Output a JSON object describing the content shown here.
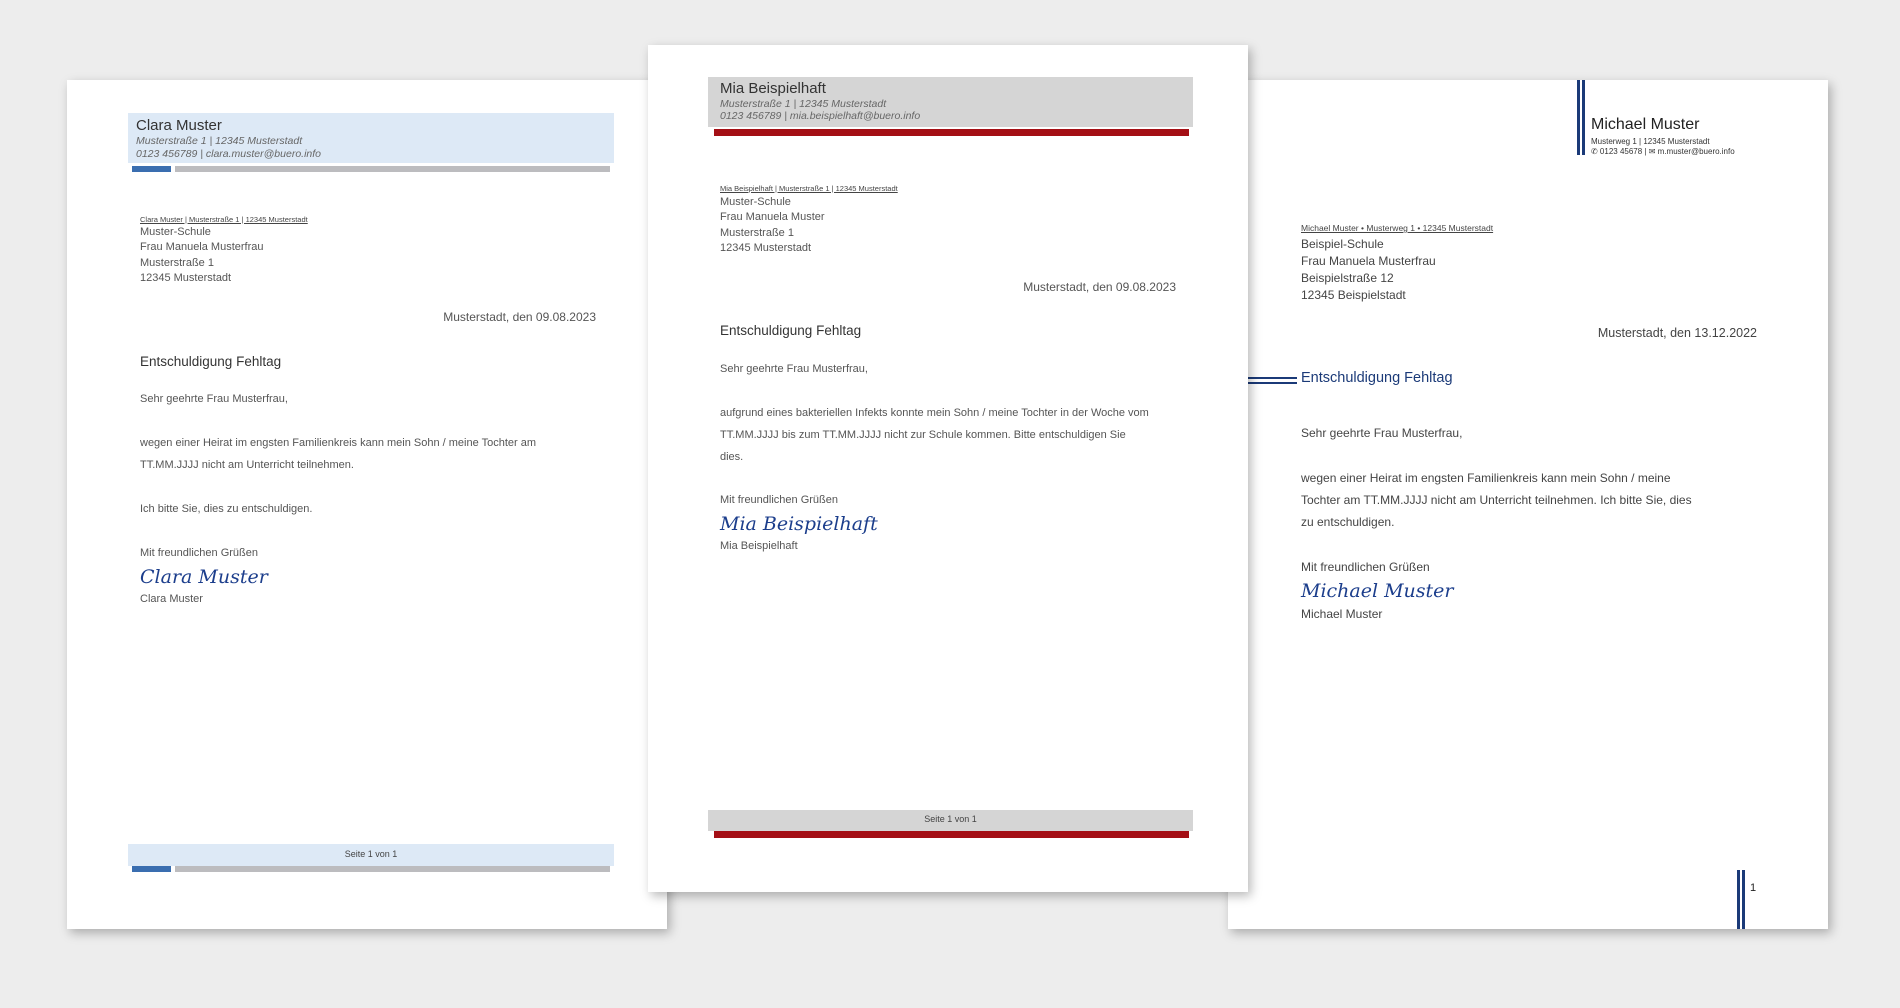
{
  "letter1": {
    "sender_name": "Clara Muster",
    "sender_address": "Musterstraße 1 | 12345 Musterstadt",
    "sender_contact": "0123 456789 | clara.muster@buero.info",
    "return_line": "Clara Muster | Musterstraße 1 | 12345 Musterstadt",
    "recipient": [
      "Muster-Schule",
      "Frau Manuela Musterfrau",
      "Musterstraße 1",
      "12345 Musterstadt"
    ],
    "date": "Musterstadt, den 09.08.2023",
    "subject": "Entschuldigung Fehltag",
    "salutation": "Sehr geehrte Frau Musterfrau,",
    "body_lines": [
      "wegen einer Heirat im engsten Familienkreis kann mein Sohn / meine Tochter am",
      "TT.MM.JJJJ nicht am Unterricht teilnehmen."
    ],
    "body2": "Ich bitte Sie, dies zu entschuldigen.",
    "closing": "Mit freundlichen Grüßen",
    "signature": "Clara Muster",
    "signer": "Clara Muster",
    "footer": "Seite 1 von 1",
    "accent_color": "#3a6eb0"
  },
  "letter2": {
    "sender_name": "Mia Beispielhaft",
    "sender_address": "Musterstraße 1 | 12345 Musterstadt",
    "sender_contact": "0123 456789 | mia.beispielhaft@buero.info",
    "return_line": "Mia Beispielhaft | Musterstraße 1 | 12345 Musterstadt",
    "recipient": [
      "Muster-Schule",
      "Frau Manuela Muster",
      "Musterstraße 1",
      "12345 Musterstadt"
    ],
    "date": "Musterstadt, den 09.08.2023",
    "subject": "Entschuldigung Fehltag",
    "salutation": "Sehr geehrte Frau Musterfrau,",
    "body_lines": [
      "aufgrund eines bakteriellen Infekts konnte mein Sohn / meine Tochter in der Woche vom",
      "TT.MM.JJJJ bis zum TT.MM.JJJJ nicht zur Schule kommen. Bitte entschuldigen Sie",
      "dies."
    ],
    "closing": "Mit freundlichen Grüßen",
    "signature": "Mia Beispielhaft",
    "signer": "Mia Beispielhaft",
    "footer": "Seite 1 von 1",
    "accent_color": "#a40f15"
  },
  "letter3": {
    "sender_name": "Michael Muster",
    "sender_address": "Musterweg 1 | 12345 Musterstadt",
    "sender_contact": "✆ 0123 45678 | ✉ m.muster@buero.info",
    "return_line": "Michael Muster • Musterweg 1 • 12345 Musterstadt",
    "recipient": [
      "Beispiel-Schule",
      "Frau Manuela Musterfrau",
      "Beispielstraße 12",
      "12345 Beispielstadt"
    ],
    "date": "Musterstadt, den 13.12.2022",
    "subject": "Entschuldigung Fehltag",
    "salutation": "Sehr geehrte Frau Musterfrau,",
    "body_lines": [
      "wegen einer Heirat im engsten Familienkreis kann mein Sohn / meine",
      "Tochter am TT.MM.JJJJ nicht am Unterricht teilnehmen. Ich bitte Sie, dies",
      "zu entschuldigen."
    ],
    "closing": "Mit freundlichen Grüßen",
    "signature": "Michael Muster",
    "signer": "Michael Muster",
    "page_number": "1",
    "accent_color": "#1b3a78"
  }
}
